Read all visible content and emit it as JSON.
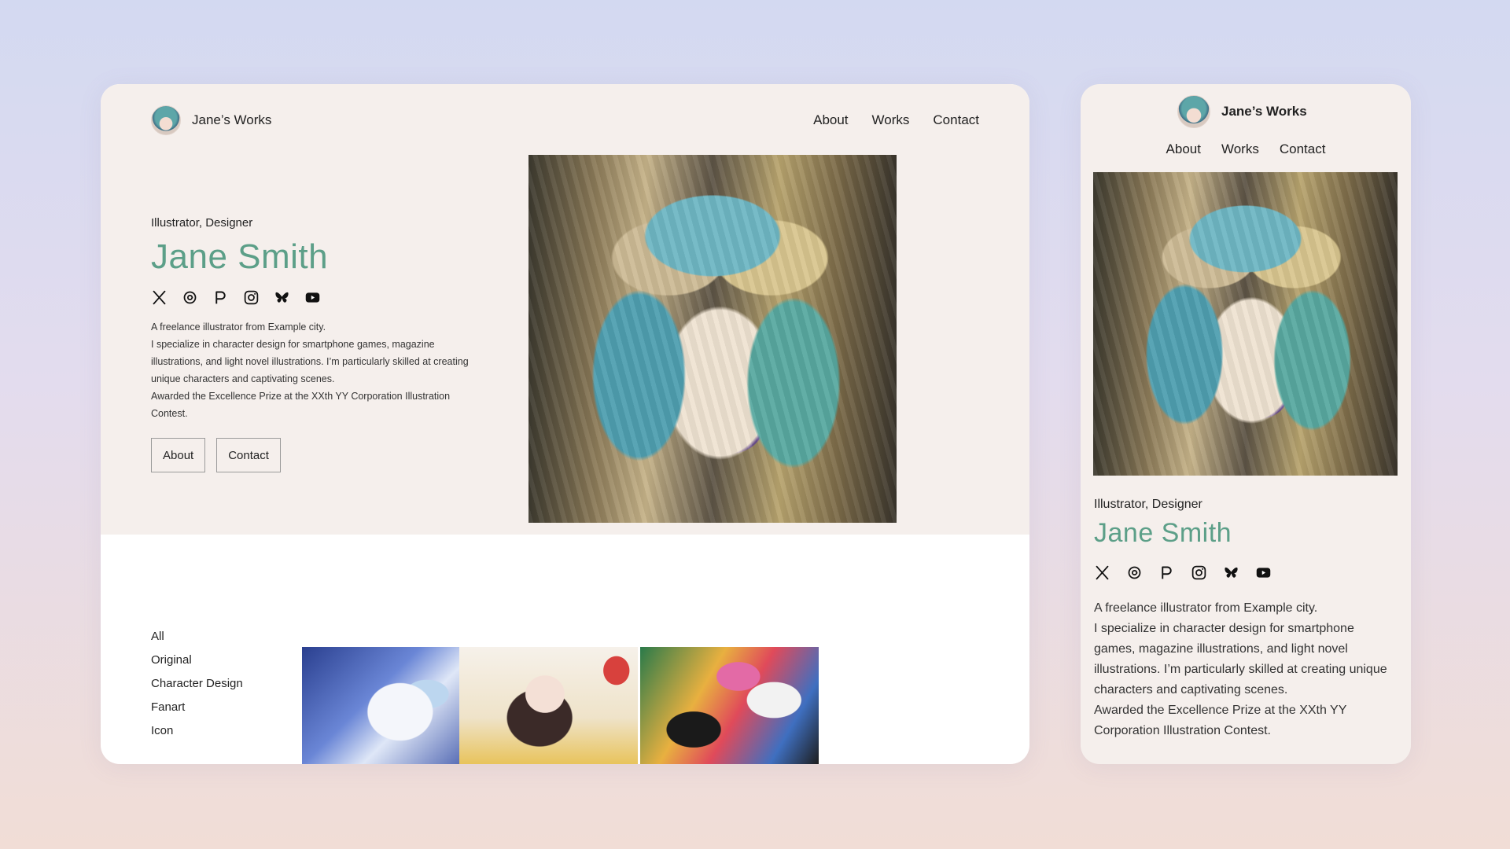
{
  "brand": {
    "name": "Jane’s Works"
  },
  "nav": {
    "about": "About",
    "works": "Works",
    "contact": "Contact"
  },
  "hero": {
    "role": "Illustrator, Designer",
    "name": "Jane Smith",
    "bio": [
      "A freelance illustrator from Example city.",
      "I specialize in character design for smartphone games, magazine illustrations, and light novel illustrations. I’m particularly skilled at creating unique characters and captivating scenes.",
      "Awarded the Excellence Prize at the XXth YY Corporation Illustration Contest."
    ],
    "buttons": {
      "about": "About",
      "contact": "Contact"
    },
    "socials": [
      "x-icon",
      "threads-icon",
      "pixiv-icon",
      "instagram-icon",
      "bluesky-icon",
      "youtube-icon"
    ]
  },
  "filters": [
    "All",
    "Original",
    "Character Design",
    "Fanart",
    "Icon"
  ],
  "colors": {
    "accent": "#5c9f88",
    "hero_bg": "#f5efec"
  }
}
